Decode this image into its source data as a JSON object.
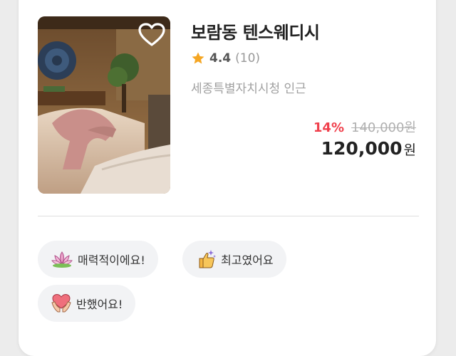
{
  "listing": {
    "title": "보람동 텐스웨디시",
    "rating": "4.4",
    "review_count": "(10)",
    "location": "세종특별자치시청 인근",
    "discount": "14%",
    "original_price": "140,000원",
    "price": "120,000",
    "currency": "원",
    "favorite": false
  },
  "reactions": [
    {
      "label": "매력적이에요!",
      "icon": "lotus-icon"
    },
    {
      "label": "최고였어요",
      "icon": "thumbs-up-sparkle-icon"
    },
    {
      "label": "반했어요!",
      "icon": "heart-hands-icon"
    }
  ],
  "colors": {
    "discount": "#f0404c",
    "star": "#f5a623",
    "chip_bg": "#f2f3f5"
  }
}
